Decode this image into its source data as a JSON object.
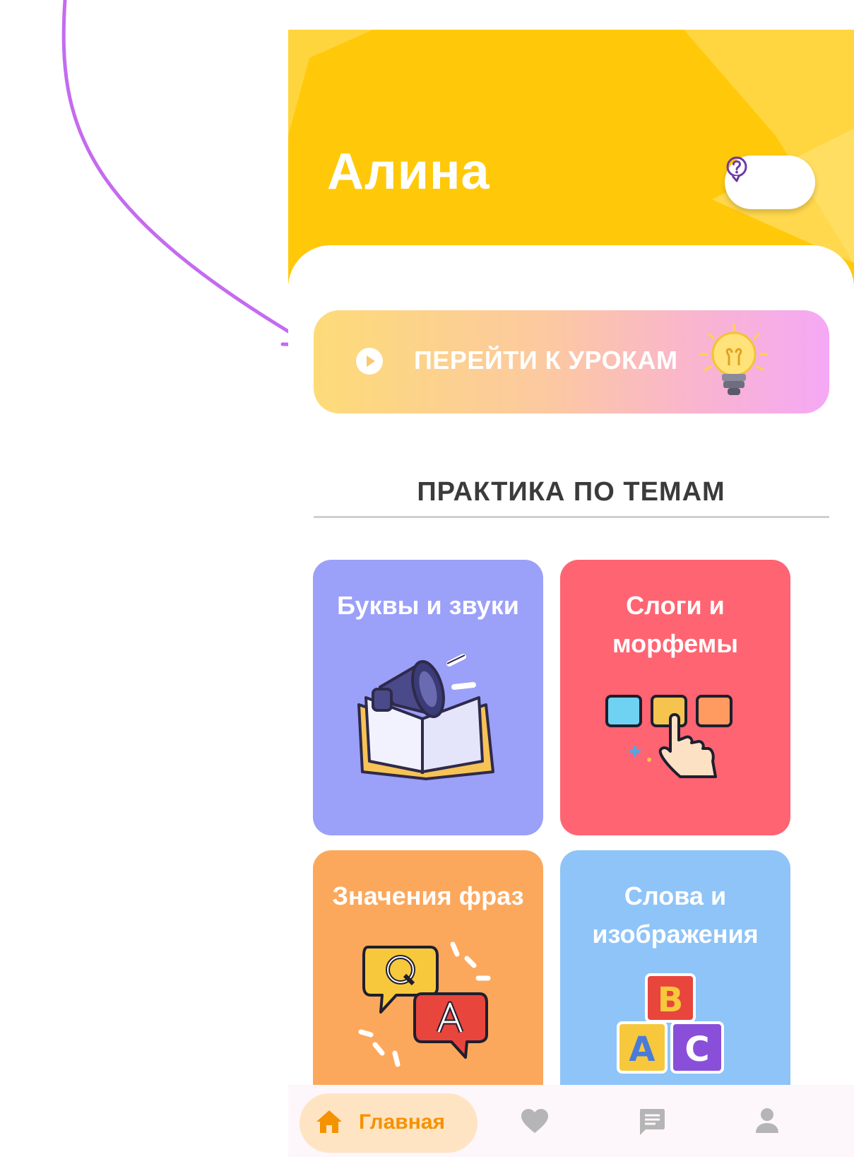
{
  "header": {
    "username": "Алина",
    "help_icon": "question-circle-icon",
    "background_color": "#FFC90A"
  },
  "lessons_button": {
    "label": "ПЕРЕЙТИ К УРОКАМ",
    "icon": "play-icon",
    "illustration": "lightbulb-icon"
  },
  "practice": {
    "title": "ПРАКТИКА ПО ТЕМАМ",
    "cards": [
      {
        "title": "Буквы и звуки",
        "color": "#9BA0F9",
        "illustration": "megaphone-book-icon"
      },
      {
        "title": "Слоги и морфемы",
        "color": "#FF6472",
        "illustration": "syllable-blocks-icon"
      },
      {
        "title": "Значения фраз",
        "color": "#FCA85C",
        "illustration": "qa-bubbles-icon"
      },
      {
        "title": "Слова и изображения",
        "color": "#8EC4F8",
        "illustration": "abc-blocks-icon"
      }
    ]
  },
  "bottom_nav": {
    "items": [
      {
        "label": "Главная",
        "icon": "home-icon",
        "active": true
      },
      {
        "label": "",
        "icon": "heart-icon",
        "active": false
      },
      {
        "label": "",
        "icon": "chat-icon",
        "active": false
      },
      {
        "label": "",
        "icon": "profile-icon",
        "active": false
      }
    ],
    "active_color": "#F59200"
  },
  "annotation_arrow_color": "#C46BF0"
}
